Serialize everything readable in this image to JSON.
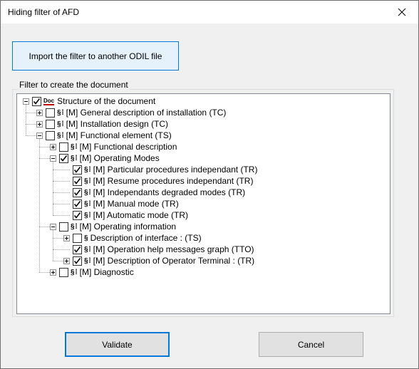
{
  "window": {
    "title": "Hiding filter of AFD"
  },
  "import_button": {
    "label": "Import the filter to another ODIL file"
  },
  "filter_group": {
    "label": "Filter to create the document"
  },
  "tree": [
    {
      "label": "Structure of the document",
      "checked": true,
      "expander": "minus",
      "icon": "Doc",
      "level": 0
    },
    {
      "label": "[M] General description of installation (TC)",
      "checked": false,
      "expander": "plus",
      "icon": "§ ⁞",
      "level": 1
    },
    {
      "label": "[M] Installation design (TC)",
      "checked": false,
      "expander": "plus",
      "icon": "§ ⁞",
      "level": 1
    },
    {
      "label": "[M] Functional element (TS)",
      "checked": false,
      "expander": "minus",
      "icon": "§ ⁞",
      "level": 1
    },
    {
      "label": "[M] Functional description",
      "checked": false,
      "expander": "plus",
      "icon": "§ ⁞",
      "level": 2
    },
    {
      "label": "[M] Operating Modes",
      "checked": true,
      "expander": "minus",
      "icon": "§ ⁞",
      "level": 2
    },
    {
      "label": "[M] Particular procedures independant (TR)",
      "checked": true,
      "expander": "",
      "icon": "§ ⁞",
      "level": 3
    },
    {
      "label": "[M] Resume procedures independant (TR)",
      "checked": true,
      "expander": "",
      "icon": "§ ⁞",
      "level": 3
    },
    {
      "label": "[M] Independants degraded modes (TR)",
      "checked": true,
      "expander": "",
      "icon": "§ ⁞",
      "level": 3
    },
    {
      "label": "[M] Manual mode (TR)",
      "checked": true,
      "expander": "",
      "icon": "§ ⁞",
      "level": 3
    },
    {
      "label": "[M] Automatic mode (TR)",
      "checked": true,
      "expander": "",
      "icon": "§ ⁞",
      "level": 3
    },
    {
      "label": "[M] Operating information",
      "checked": false,
      "expander": "minus",
      "icon": "§ ⁞",
      "level": 2
    },
    {
      "label": "Description of interface : (TS)",
      "checked": false,
      "expander": "plus",
      "icon": "§",
      "level": 3
    },
    {
      "label": "[M] Operation help messages graph (TTO)",
      "checked": true,
      "expander": "",
      "icon": "§ ⁞",
      "level": 3
    },
    {
      "label": "[M] Description of Operator Terminal : (TR)",
      "checked": true,
      "expander": "plus",
      "icon": "§ ⁞",
      "level": 3
    },
    {
      "label": "[M] Diagnostic",
      "checked": false,
      "expander": "plus",
      "icon": "§ ⁞",
      "level": 2
    }
  ],
  "buttons": {
    "validate": "Validate",
    "cancel": "Cancel"
  }
}
